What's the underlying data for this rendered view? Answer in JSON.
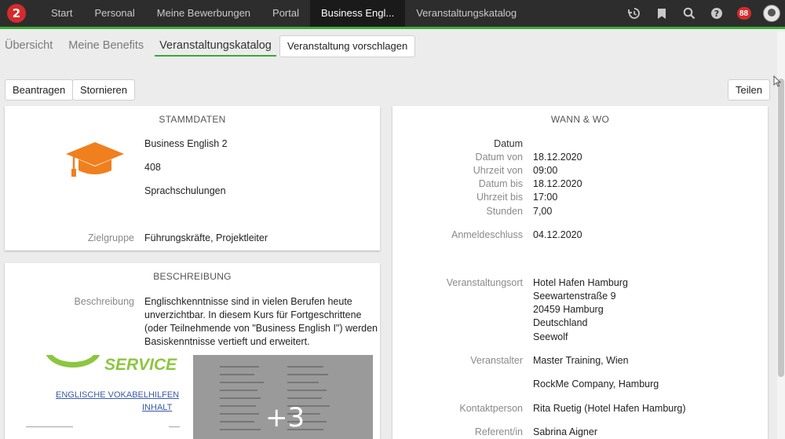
{
  "nav": {
    "logo": "2",
    "items": [
      "Start",
      "Personal",
      "Meine Bewerbungen",
      "Portal",
      "Business Engl...",
      "Veranstaltungskatalog"
    ],
    "badge": "88",
    "icons": [
      "history-icon",
      "bookmark-icon",
      "search-icon",
      "help-icon",
      "notifications-badge",
      "avatar"
    ]
  },
  "subnav": {
    "tabs": [
      "Übersicht",
      "Meine Benefits",
      "Veranstaltungskatalog"
    ],
    "suggest_button": "Veranstaltung vorschlagen"
  },
  "actions": {
    "apply": "Beantragen",
    "cancel": "Stornieren",
    "share": "Teilen"
  },
  "stammdaten": {
    "title": "STAMMDATEN",
    "name": "Business English 2",
    "number": "408",
    "category": "Sprachschulungen",
    "target_label": "Zielgruppe",
    "target_value": "Führungskräfte, Projektleiter",
    "icon": "graduation-cap-icon",
    "icon_color": "#f07f1e"
  },
  "beschreibung": {
    "title": "BESCHREIBUNG",
    "label": "Beschreibung",
    "lines": [
      "Englischkenntnisse sind in vielen Berufen heute",
      "unverzichtbar. In diesem Kurs für Fortgeschrittene",
      "(oder Teilnehmende von \"Business English I\") werden",
      "Basiskenntnisse vertieft und erweitert."
    ],
    "thumb1_title": "SERVICE",
    "thumb1_heading1": "ENGLISCHE VOKABELHILFEN",
    "thumb1_heading2": "INHALT",
    "more": "+3"
  },
  "wannwo": {
    "title": "WANN & WO",
    "datum_head": "Datum",
    "rows": [
      {
        "label": "Datum von",
        "value": "18.12.2020"
      },
      {
        "label": "Uhrzeit von",
        "value": "09:00"
      },
      {
        "label": "Datum bis",
        "value": "18.12.2020"
      },
      {
        "label": "Uhrzeit bis",
        "value": "17:00"
      },
      {
        "label": "Stunden",
        "value": "7,00"
      }
    ],
    "anmeldeschluss_label": "Anmeldeschluss",
    "anmeldeschluss_value": "04.12.2020",
    "ort_label": "Veranstaltungsort",
    "ort_lines": [
      "Hotel Hafen Hamburg",
      "Seewartenstraße 9",
      "20459 Hamburg",
      "Deutschland",
      "Seewolf"
    ],
    "veranstalter_label": "Veranstalter",
    "veranstalter_1": "Master Training, Wien",
    "veranstalter_2": "RockMe Company, Hamburg",
    "kontakt_label": "Kontaktperson",
    "kontakt_value": "Rita Ruetig (Hotel Hafen Hamburg)",
    "referent_label": "Referent/in",
    "referent_value": "Sabrina Aigner"
  },
  "colors": {
    "accent": "#3aaa35",
    "brand_red": "#d52b2b"
  }
}
